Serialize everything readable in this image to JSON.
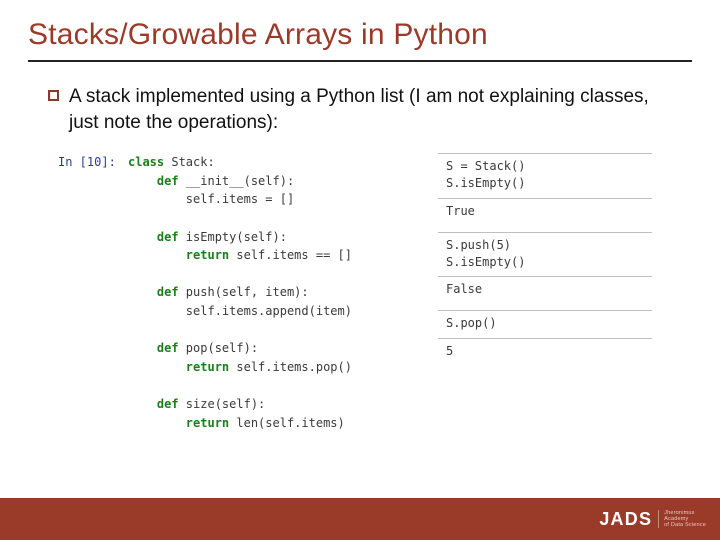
{
  "title": "Stacks/Growable Arrays in Python",
  "bullet": "A stack implemented using a Python list (I am not explaining classes, just note the operations):",
  "prompt": "In [10]:",
  "code": {
    "l1a": "class",
    "l1b": " Stack:",
    "l2a": "    def",
    "l2b": " __init__(self):",
    "l3": "        self.items = []",
    "l4a": "    def",
    "l4b": " isEmpty(self):",
    "l5a": "        return",
    "l5b": " self.items == []",
    "l6a": "    def",
    "l6b": " push(self, item):",
    "l7": "        self.items.append(item)",
    "l8a": "    def",
    "l8b": " pop(self):",
    "l9a": "        return",
    "l9b": " self.items.pop()",
    "l10a": "    def",
    "l10b": " size(self):",
    "l11a": "        return",
    "l11b": " len(self.items)"
  },
  "right": {
    "cell1": "S = Stack()\nS.isEmpty()",
    "out1": "True",
    "cell2": "S.push(5)\nS.isEmpty()",
    "out2": "False",
    "cell3": "S.pop()",
    "out3": "5"
  },
  "logo": {
    "text": "JADS",
    "sub1": "Jheronimus",
    "sub2": "Academy",
    "sub3": "of Data Science"
  },
  "colors": {
    "accent": "#9a3b2a"
  }
}
